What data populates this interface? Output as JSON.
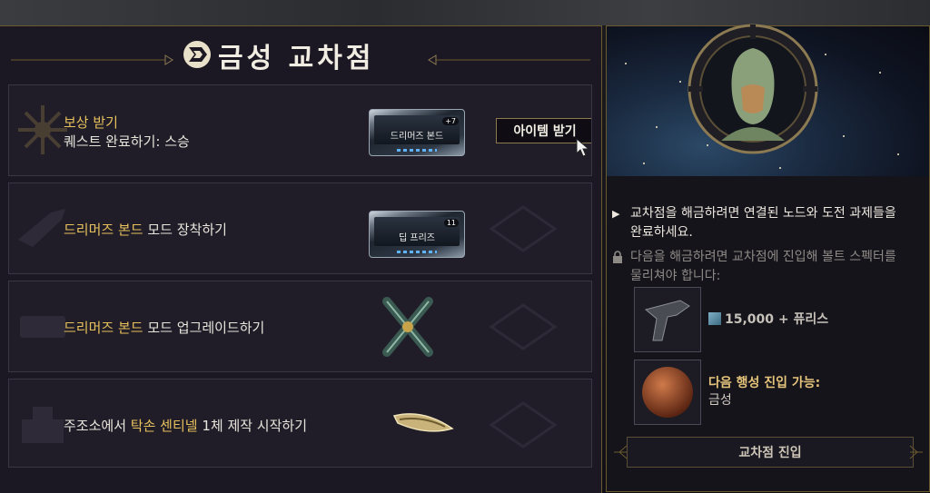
{
  "header": {
    "title": "금성 교차점"
  },
  "rows": [
    {
      "label_gold": "보상 받기",
      "label_main": "퀘스트 완료하기: 스승",
      "reward_mod": {
        "name": "드리머즈 본드",
        "rank": "+7"
      },
      "claim_button": "아이템 받기"
    },
    {
      "label_gold": "드리머즈 본드",
      "label_main": " 모드 장착하기",
      "reward_mod": {
        "name": "딥 프리즈",
        "rank": "11"
      }
    },
    {
      "label_gold": "드리머즈 본드",
      "label_main": " 모드 업그레이드하기"
    },
    {
      "label_prefix": "주조소에서 ",
      "label_gold": "탁손 센티넬",
      "label_main": " 1체 제작 시작하기"
    }
  ],
  "sidebar": {
    "objective": "교차점을 해금하려면 연결된 노드와 도전 과제들을 완료하세요.",
    "locked": "다음을 해금하려면 교차점에 진입해 볼트 스펙터를 물리쳐야 합니다:",
    "cost": "15,000 + 퓨리스",
    "next_planet_label": "다음 행성 진입 가능:",
    "next_planet": "금성",
    "enter_button": "교차점 진입"
  },
  "colors": {
    "gold": "#e7c15b",
    "panel": "#1b1823",
    "border": "#6b5a2e"
  }
}
